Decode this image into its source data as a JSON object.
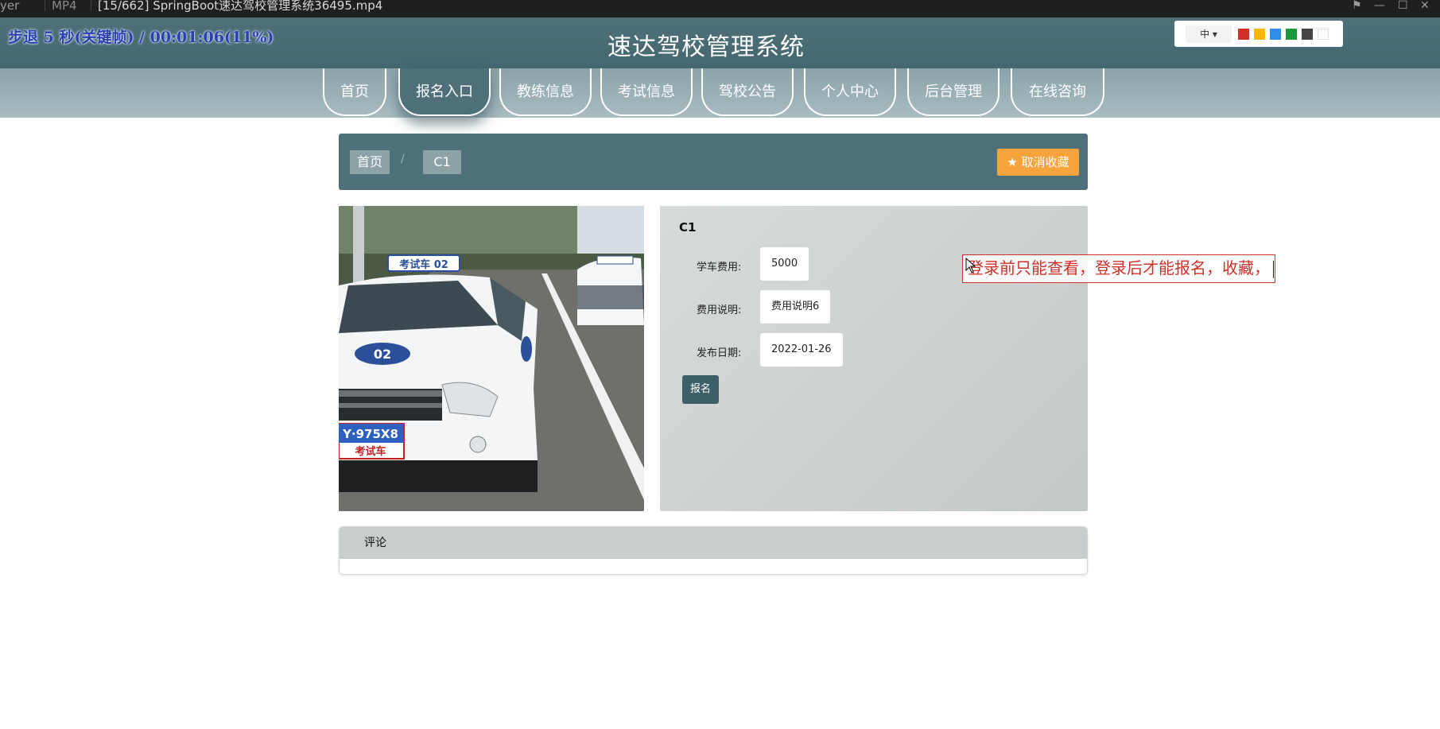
{
  "player": {
    "app_label": "yer",
    "format": "MP4",
    "file_title": "[15/662] SpringBoot速达驾校管理系统36495.mp4"
  },
  "overlay": {
    "status": "步退 5 秒(关键帧) / 00:01:06(11%)"
  },
  "header": {
    "title": "速达驾校管理系统"
  },
  "theme": {
    "lang": "中 ▾",
    "swatches": [
      "#d0302a",
      "#f5b800",
      "#2e8ee8",
      "#1a9a3a",
      "#444444",
      "#ffffff"
    ]
  },
  "nav": {
    "items": [
      {
        "label": "首页"
      },
      {
        "label": "报名入口"
      },
      {
        "label": "教练信息"
      },
      {
        "label": "考试信息"
      },
      {
        "label": "驾校公告"
      },
      {
        "label": "个人中心"
      },
      {
        "label": "后台管理"
      },
      {
        "label": "在线咨询"
      }
    ],
    "active_index": 1
  },
  "breadcrumb": {
    "home": "首页",
    "separator": "/",
    "current": "C1"
  },
  "favorite": {
    "label": "★ 取消收藏"
  },
  "detail": {
    "name": "C1",
    "fields": [
      {
        "label": "学车费用:",
        "value": "5000"
      },
      {
        "label": "费用说明:",
        "value": "费用说明6"
      },
      {
        "label": "发布日期:",
        "value": "2022-01-26"
      }
    ],
    "signup_label": "报名"
  },
  "annotation": {
    "text": "登录前只能查看，登录后才能报名，收藏，"
  },
  "comments": {
    "title": "评论"
  },
  "photo": {
    "plate": "Y·975X8",
    "roof_sign": "考试车 02",
    "door_number": "02",
    "plate_sub": "考试车"
  }
}
